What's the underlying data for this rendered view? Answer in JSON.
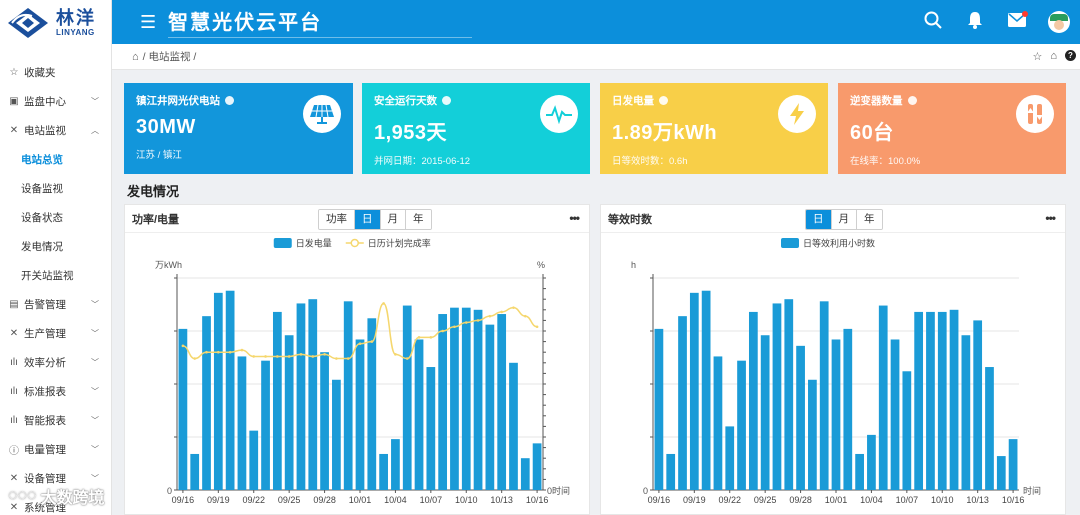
{
  "brand": {
    "name_cn": "林洋",
    "name_en": "LINYANG"
  },
  "header": {
    "title": "智慧光伏云平台"
  },
  "sidebar": {
    "items": [
      {
        "label": "收藏夹",
        "icon": "star-icon",
        "chevron": ""
      },
      {
        "label": "监盘中心",
        "icon": "monitor-icon",
        "chevron": "down"
      },
      {
        "label": "电站监视",
        "icon": "tools-icon",
        "chevron": "up"
      }
    ],
    "sub_items": [
      {
        "label": "电站总览",
        "active": true
      },
      {
        "label": "设备监视",
        "active": false
      },
      {
        "label": "设备状态",
        "active": false
      },
      {
        "label": "发电情况",
        "active": false
      },
      {
        "label": "开关站监视",
        "active": false
      }
    ],
    "items2": [
      {
        "label": "告警管理",
        "icon": "alarm-icon"
      },
      {
        "label": "生产管理",
        "icon": "tools-icon"
      },
      {
        "label": "效率分析",
        "icon": "chart-icon"
      },
      {
        "label": "标准报表",
        "icon": "chart-icon"
      },
      {
        "label": "智能报表",
        "icon": "chart-icon"
      },
      {
        "label": "电量管理",
        "icon": "info-icon"
      },
      {
        "label": "设备管理",
        "icon": "tools-icon"
      },
      {
        "label": "系统管理",
        "icon": "tools-icon"
      }
    ]
  },
  "breadcrumb": {
    "path": "/ 电站监视 /"
  },
  "cards": [
    {
      "title": "镇江井网光伏电站",
      "value": "30MW",
      "sub": "江苏 / 镇江",
      "color": "#1296db",
      "icon": "solar-panel-icon"
    },
    {
      "title": "安全运行天数",
      "value": "1,953天",
      "sub": "并网日期：2015-06-12",
      "color": "#13cfd9",
      "icon": "pulse-icon"
    },
    {
      "title": "日发电量",
      "value": "1.89万kWh",
      "sub": "日等效时数：0.6h",
      "color": "#f8cf48",
      "icon": "lightning-icon"
    },
    {
      "title": "逆变器数量",
      "value": "60台",
      "sub": "在线率：100.0%",
      "color": "#f89a6c",
      "icon": "inverter-icon"
    }
  ],
  "section": {
    "title": "发电情况"
  },
  "panels": {
    "left": {
      "title": "功率/电量",
      "tabs": [
        "功率",
        "日",
        "月",
        "年"
      ],
      "active_tab": 1
    },
    "right": {
      "title": "等效时数",
      "tabs": [
        "日",
        "月",
        "年"
      ],
      "active_tab": 0
    }
  },
  "watermark": {
    "text": "大数跨境"
  },
  "chart_data": [
    {
      "type": "bar",
      "title": "",
      "x": [
        "09/16",
        "09/17",
        "09/18",
        "09/19",
        "09/20",
        "09/21",
        "09/22",
        "09/23",
        "09/24",
        "09/25",
        "09/26",
        "09/27",
        "09/28",
        "09/29",
        "09/30",
        "10/01",
        "10/02",
        "10/03",
        "10/04",
        "10/05",
        "10/06",
        "10/07",
        "10/08",
        "10/09",
        "10/10",
        "10/11",
        "10/12",
        "10/13",
        "10/14",
        "10/15",
        "10/16"
      ],
      "xticks": [
        "09/16",
        "09/19",
        "09/22",
        "09/25",
        "09/28",
        "10/01",
        "10/04",
        "10/07",
        "10/10",
        "10/13",
        "10/16"
      ],
      "xlabel": "时间",
      "ylabel": "万kWh",
      "y2label": "%",
      "x_end_label": "时间",
      "y_zero_label": "0",
      "y2_zero_label": "0",
      "colors": {
        "bar": "#1a9bd7",
        "line": "#f5d76e"
      },
      "series": [
        {
          "name": "日发电量",
          "type": "bar",
          "values": [
            0.76,
            0.17,
            0.82,
            0.93,
            0.94,
            0.63,
            0.28,
            0.61,
            0.84,
            0.73,
            0.88,
            0.9,
            0.65,
            0.52,
            0.89,
            0.71,
            0.81,
            0.17,
            0.24,
            0.87,
            0.71,
            0.58,
            0.83,
            0.86,
            0.86,
            0.85,
            0.78,
            0.83,
            0.6,
            0.15,
            0.22
          ]
        },
        {
          "name": "日历计划完成率",
          "type": "line",
          "axis": "right",
          "values": [
            0.68,
            0.62,
            0.65,
            0.65,
            0.65,
            0.66,
            0.63,
            0.63,
            0.63,
            0.63,
            0.64,
            0.63,
            0.64,
            0.62,
            0.62,
            0.69,
            0.7,
            0.88,
            0.64,
            0.62,
            0.72,
            0.72,
            0.75,
            0.77,
            0.79,
            0.8,
            0.82,
            0.84,
            0.86,
            0.82,
            0.77
          ]
        }
      ],
      "ylim": [
        0,
        1
      ],
      "grid": true,
      "legend": "top"
    },
    {
      "type": "bar",
      "title": "",
      "x": [
        "09/16",
        "09/17",
        "09/18",
        "09/19",
        "09/20",
        "09/21",
        "09/22",
        "09/23",
        "09/24",
        "09/25",
        "09/26",
        "09/27",
        "09/28",
        "09/29",
        "09/30",
        "10/01",
        "10/02",
        "10/03",
        "10/04",
        "10/05",
        "10/06",
        "10/07",
        "10/08",
        "10/09",
        "10/10",
        "10/11",
        "10/12",
        "10/13",
        "10/14",
        "10/15",
        "10/16"
      ],
      "xticks": [
        "09/16",
        "09/19",
        "09/22",
        "09/25",
        "09/28",
        "10/01",
        "10/04",
        "10/07",
        "10/10",
        "10/13",
        "10/16"
      ],
      "xlabel": "时间",
      "ylabel": "h",
      "x_end_label": "时间",
      "y_zero_label": "0",
      "colors": {
        "bar": "#1a9bd7"
      },
      "series": [
        {
          "name": "日等效利用小时数",
          "type": "bar",
          "values": [
            0.76,
            0.17,
            0.82,
            0.93,
            0.94,
            0.63,
            0.3,
            0.61,
            0.84,
            0.73,
            0.88,
            0.9,
            0.68,
            0.52,
            0.89,
            0.71,
            0.76,
            0.17,
            0.26,
            0.87,
            0.71,
            0.56,
            0.84,
            0.84,
            0.84,
            0.85,
            0.73,
            0.8,
            0.58,
            0.16,
            0.24
          ]
        }
      ],
      "ylim": [
        0,
        1
      ],
      "grid": true,
      "legend": "top"
    }
  ]
}
